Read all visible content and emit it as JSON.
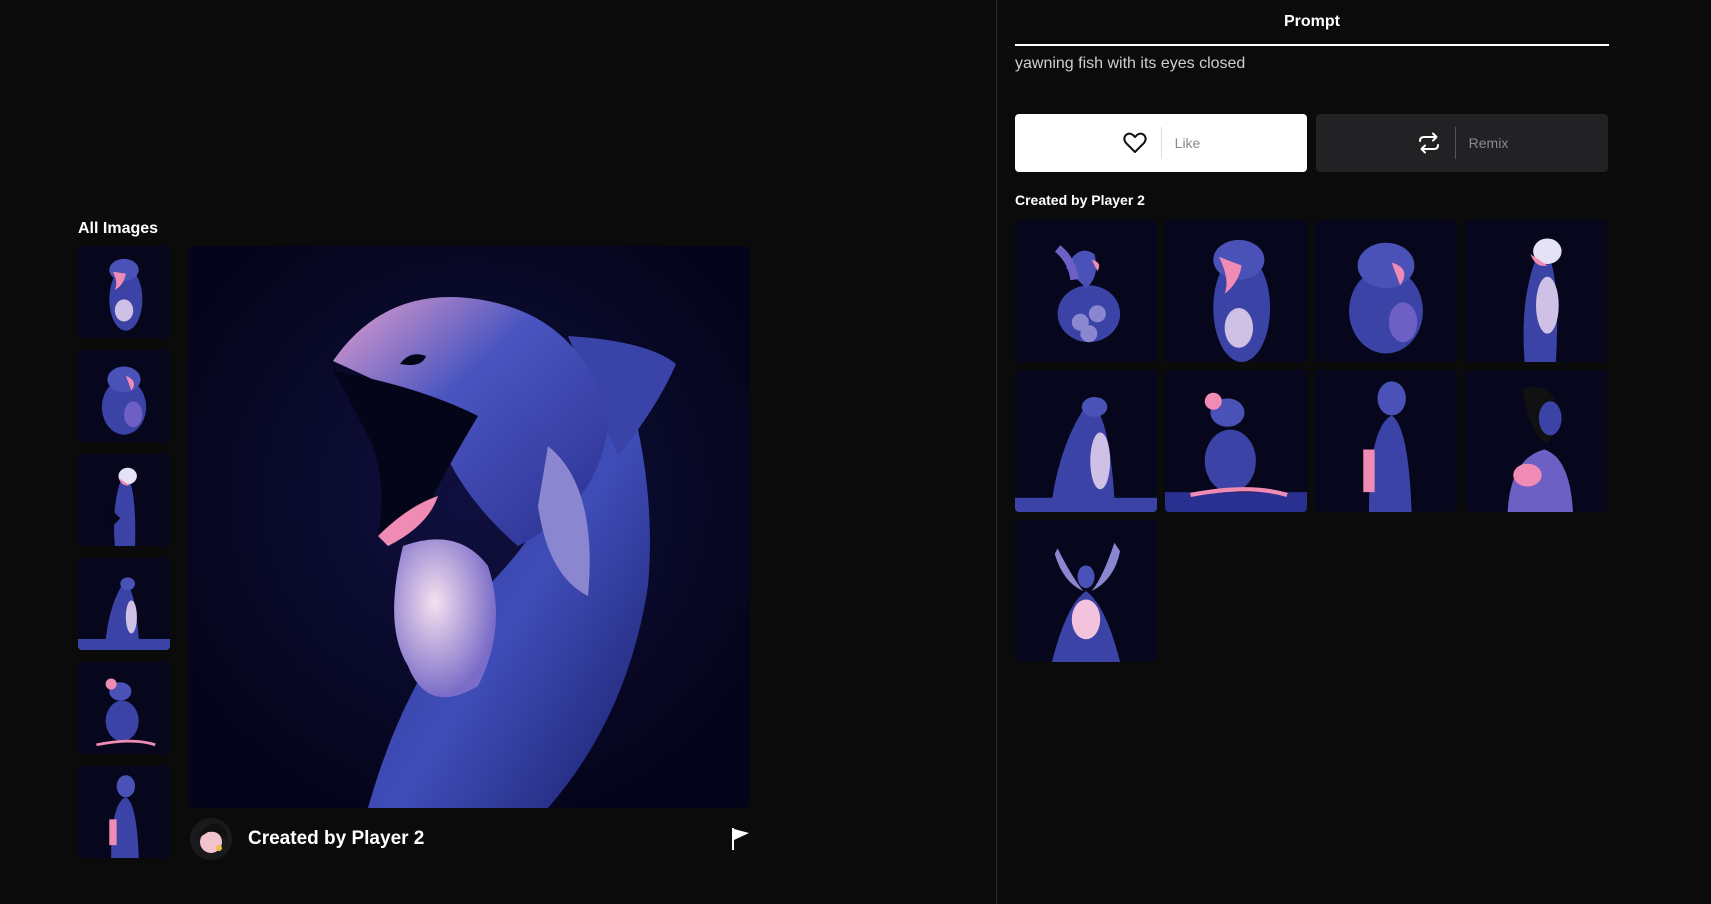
{
  "left": {
    "all_images_title": "All Images",
    "thumbnails": [
      "shark",
      "fish-blob",
      "fish-up",
      "seal",
      "mouse",
      "man"
    ],
    "main_image": "whale-yawning",
    "creator_name": "Created by Player 2"
  },
  "right": {
    "tab_label": "Prompt",
    "prompt_text": "yawning fish with its eyes closed",
    "like_label": "Like",
    "remix_label": "Remix",
    "gallery_title": "Created by Player 2",
    "gallery": [
      "bird",
      "shark",
      "fish-blob",
      "fish-up",
      "seal",
      "mouse",
      "man",
      "woman",
      "fairy"
    ]
  },
  "colors": {
    "background": "#0b0b0c",
    "image_bg": "#06061c",
    "figure_blue": "#3b44a6",
    "figure_pink": "#f08bb3",
    "like_button": "#ffffff",
    "remix_button": "#222224"
  }
}
